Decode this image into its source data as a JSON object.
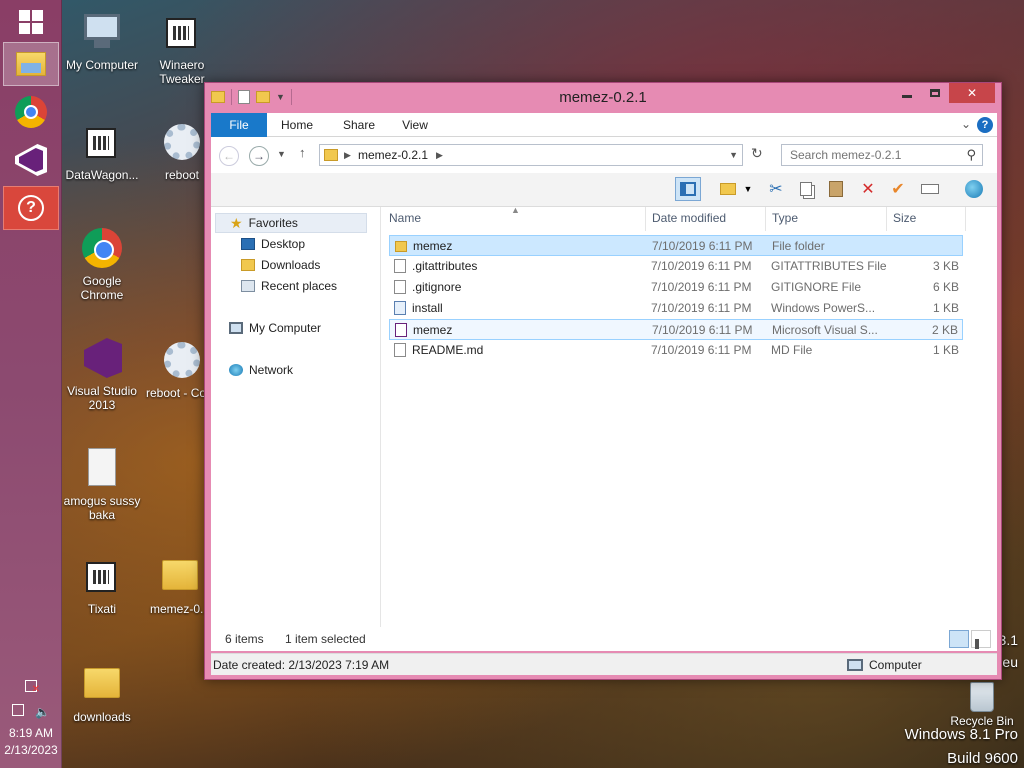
{
  "taskbar": {
    "items": [
      {
        "name": "start-button",
        "icon": "windows-logo-icon"
      },
      {
        "name": "file-explorer",
        "icon": "file-explorer-icon",
        "active": true
      },
      {
        "name": "chrome",
        "icon": "chrome-icon"
      },
      {
        "name": "visual-studio",
        "icon": "visual-studio-icon"
      },
      {
        "name": "help",
        "icon": "help-icon",
        "label": "?"
      }
    ],
    "time": "8:19 AM",
    "date": "2/13/2023"
  },
  "desktop": {
    "icons": [
      {
        "label": "My Computer"
      },
      {
        "label": "Winaero Tweaker"
      },
      {
        "label": "DataWagon..."
      },
      {
        "label": "reboot"
      },
      {
        "label": "Google Chrome"
      },
      {
        "label": "Visual Studio 2013"
      },
      {
        "label": "reboot - Co"
      },
      {
        "label": "amogus sussy baka"
      },
      {
        "label": "Tixati"
      },
      {
        "label": "memez-0..."
      },
      {
        "label": "downloads"
      },
      {
        "label": "Recycle Bin"
      }
    ],
    "watermark": {
      "line1": "Windows 8.1 Pro",
      "line2": "Build 9600"
    },
    "partial_text": {
      "a": "3.1",
      "b": "eu"
    }
  },
  "window": {
    "title": "memez-0.2.1",
    "ribbon_tabs": [
      "File",
      "Home",
      "Share",
      "View"
    ],
    "address": {
      "crumb": "memez-0.2.1"
    },
    "search": {
      "placeholder": "Search memez-0.2.1"
    },
    "nav": {
      "favorites": "Favorites",
      "desktop": "Desktop",
      "downloads": "Downloads",
      "recent": "Recent places",
      "computer": "My Computer",
      "network": "Network"
    },
    "columns": {
      "name": "Name",
      "date": "Date modified",
      "type": "Type",
      "size": "Size"
    },
    "files": [
      {
        "name": "memez",
        "date": "7/10/2019 6:11 PM",
        "type": "File folder",
        "size": "",
        "icon": "folder-icon",
        "state": "selected"
      },
      {
        "name": ".gitattributes",
        "date": "7/10/2019 6:11 PM",
        "type": "GITATTRIBUTES File",
        "size": "3 KB",
        "icon": "document-icon"
      },
      {
        "name": ".gitignore",
        "date": "7/10/2019 6:11 PM",
        "type": "GITIGNORE File",
        "size": "6 KB",
        "icon": "document-icon"
      },
      {
        "name": "install",
        "date": "7/10/2019 6:11 PM",
        "type": "Windows PowerS...",
        "size": "1 KB",
        "icon": "powershell-script-icon"
      },
      {
        "name": "memez",
        "date": "7/10/2019 6:11 PM",
        "type": "Microsoft Visual S...",
        "size": "2 KB",
        "icon": "visual-studio-solution-icon",
        "state": "hover"
      },
      {
        "name": "README.md",
        "date": "7/10/2019 6:11 PM",
        "type": "MD File",
        "size": "1 KB",
        "icon": "document-icon"
      }
    ],
    "status": {
      "count": "6 items",
      "selected": "1 item selected"
    },
    "info": {
      "created": "Date created: 2/13/2023 7:19 AM",
      "location": "Computer"
    }
  }
}
